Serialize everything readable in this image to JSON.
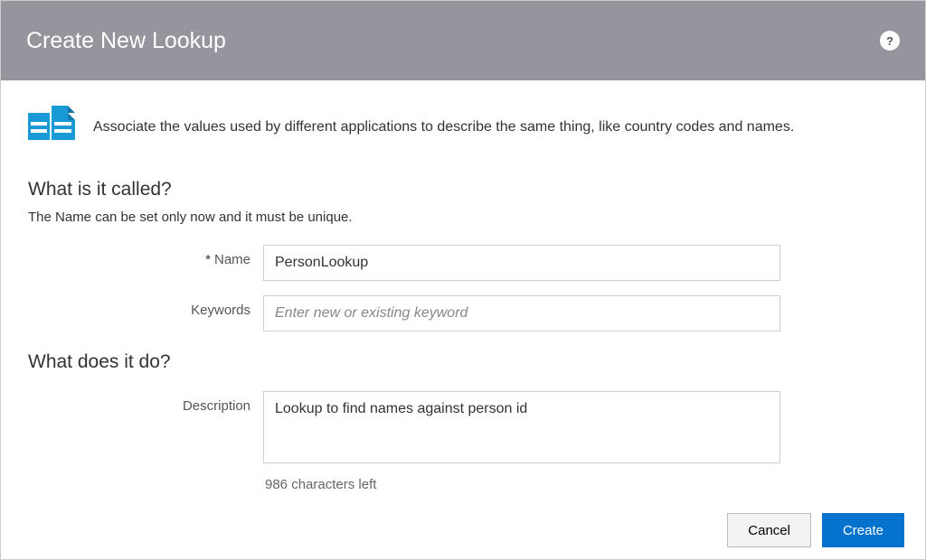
{
  "header": {
    "title": "Create New Lookup",
    "help_label": "?"
  },
  "intro_text": "Associate the values used by different applications to describe the same thing, like country codes and names.",
  "section_name": {
    "heading": "What is it called?",
    "subtext": "The Name can be set only now and it must be unique.",
    "name_label": "Name",
    "name_required_mark": "*",
    "name_value": "PersonLookup",
    "keywords_label": "Keywords",
    "keywords_placeholder": "Enter new or existing keyword",
    "keywords_value": ""
  },
  "section_desc": {
    "heading": "What does it do?",
    "desc_label": "Description",
    "desc_value": "Lookup to find names against person id",
    "char_counter": "986 characters left"
  },
  "footer": {
    "cancel_label": "Cancel",
    "create_label": "Create"
  }
}
